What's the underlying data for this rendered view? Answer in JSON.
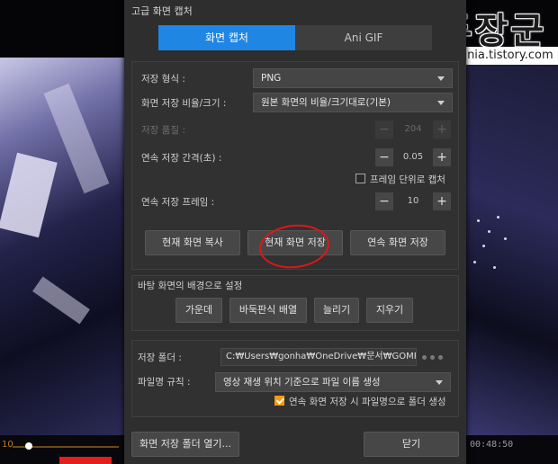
{
  "dialog": {
    "title": "고급 화면 캡처",
    "tabs": [
      {
        "label": "화면 캡처",
        "active": true
      },
      {
        "label": "Ani GIF",
        "active": false
      }
    ],
    "capture": {
      "save_format_label": "저장 형식 :",
      "save_format_value": "PNG",
      "ratio_label": "화면 저장 비율/크기 :",
      "ratio_value": "원본 화면의 비율/크기대로(기본)",
      "quality_label": "저장 품질 :",
      "quality_value": "204",
      "interval_label": "연속 저장 간격(초) :",
      "interval_value": "0.05",
      "frame_unit_label": "프레임 단위로 캡처",
      "frame_unit_checked": false,
      "frames_label": "연속 저장 프레임 :",
      "frames_value": "10",
      "buttons": {
        "copy": "현재 화면 복사",
        "save": "현재 화면 저장",
        "continuous": "연속 화면 저장"
      }
    },
    "wallpaper": {
      "heading": "바탕 화면의 배경으로 설정",
      "buttons": {
        "center": "가운데",
        "tile": "바둑판식 배열",
        "stretch": "늘리기",
        "clear": "지우기"
      }
    },
    "folder": {
      "label": "저장 폴더 :",
      "path": "C:₩Users₩gonha₩OneDrive₩문서₩GOMPlaye",
      "filename_rule_label": "파일명 규칙 :",
      "filename_rule_value": "영상 재생 위치 기준으로 파일 이름 생성",
      "create_folder_label": "연속 화면 저장 시 파일명으로 폴더 생성",
      "create_folder_checked": true
    },
    "footer": {
      "open_folder": "화면 저장 폴더 열기...",
      "close": "닫기"
    }
  },
  "watermark": {
    "title": "녹두장군",
    "url": "http://mainia.tistory.com"
  },
  "player": {
    "volume_number": "10",
    "time": "00:48:50"
  },
  "colors": {
    "accent_tab": "#1f86e4",
    "checkbox_checked": "#f39c12",
    "annotation_circle": "#e01616"
  }
}
